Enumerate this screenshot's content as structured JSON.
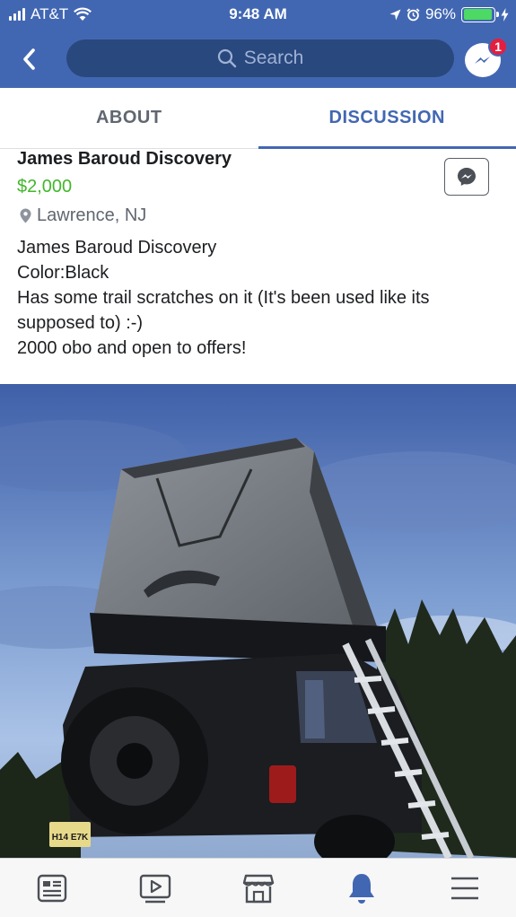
{
  "status_bar": {
    "carrier": "AT&T",
    "time": "9:48 AM",
    "battery_percent": "96%",
    "battery_level": 0.96
  },
  "header": {
    "search_placeholder": "Search",
    "messenger_badge": "1",
    "brand_color": "#4267b2"
  },
  "tabs": [
    {
      "label": "ABOUT",
      "active": false
    },
    {
      "label": "DISCUSSION",
      "active": true
    }
  ],
  "post": {
    "title": "James Baroud Discovery",
    "price": "$2,000",
    "location": "Lawrence, NJ",
    "body": [
      "James Baroud Discovery",
      "Color:Black",
      "Has some trail scratches on it (It's been used like its supposed to) :-)",
      "2000 obo and open to offers!"
    ],
    "price_color": "#42b72a"
  },
  "photo": {
    "plate_text": "H14 E7K"
  },
  "bottom_nav": [
    {
      "icon": "news-feed-icon"
    },
    {
      "icon": "watch-video-icon"
    },
    {
      "icon": "marketplace-icon"
    },
    {
      "icon": "notifications-bell-icon",
      "active": true
    },
    {
      "icon": "menu-icon"
    }
  ]
}
